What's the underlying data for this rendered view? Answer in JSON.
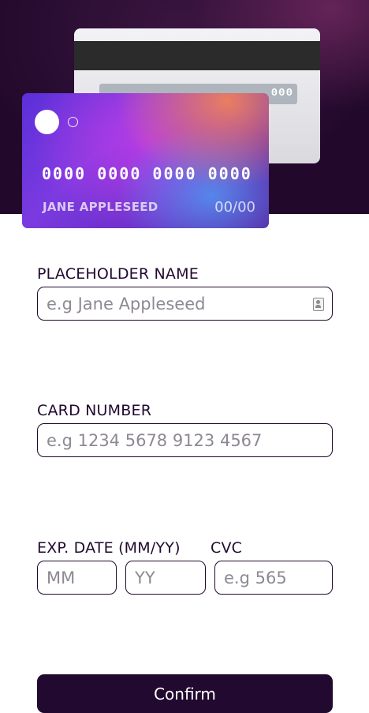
{
  "card_back": {
    "cvc": "000"
  },
  "card_front": {
    "number": "0000 0000 0000 0000",
    "name": "JANE APPLESEED",
    "expiry": "00/00"
  },
  "form": {
    "name": {
      "label": "PLACEHOLDER NAME",
      "placeholder": "e.g Jane Appleseed",
      "value": ""
    },
    "number": {
      "label": "CARD NUMBER",
      "placeholder": "e.g 1234 5678 9123 4567",
      "value": ""
    },
    "expiry": {
      "label": "EXP. DATE (MM/YY)",
      "month_placeholder": "MM",
      "year_placeholder": "YY"
    },
    "cvc": {
      "label": "CVC",
      "placeholder": "e.g 565",
      "value": ""
    },
    "confirm_label": "Confirm"
  },
  "icons": {
    "autofill": "contact-card-icon"
  },
  "colors": {
    "primary": "#21092f",
    "placeholder": "#8e8893",
    "hero_bg": "#22092b"
  }
}
